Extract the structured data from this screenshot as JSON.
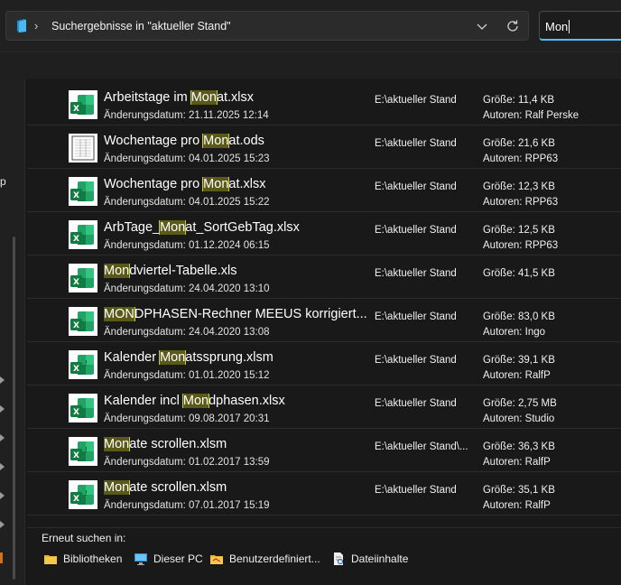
{
  "address": {
    "path": "Suchergebnisse in \"aktueller Stand\"",
    "separator": "›",
    "folder_icon": "folder-icon",
    "dropdown_icon": "chevron-down-icon",
    "refresh_icon": "refresh-icon"
  },
  "search": {
    "value": "Mon"
  },
  "nav": {
    "partial_label": "p"
  },
  "colors": {
    "accent": "#4cc2ff",
    "highlight_bg": "#5a5a1a",
    "highlight_border": "#c8c84a",
    "excel_green": "#1f9d55"
  },
  "results": [
    {
      "name_pre": "Arbeitstage im ",
      "name_hl": "Mon",
      "name_post": "at.xlsx",
      "date": "Änderungsdatum: 21.11.2025 12:14",
      "location": "E:\\aktueller Stand",
      "size": "Größe: 11,4 KB",
      "author": "Autoren: Ralf Perske",
      "icon": "excel"
    },
    {
      "name_pre": "Wochentage pro ",
      "name_hl": "Mon",
      "name_post": "at.ods",
      "date": "Änderungsdatum: 04.01.2025 15:23",
      "location": "E:\\aktueller Stand",
      "size": "Größe: 21,6 KB",
      "author": "Autoren: RPP63",
      "icon": "ods"
    },
    {
      "name_pre": "Wochentage pro ",
      "name_hl": "Mon",
      "name_post": "at.xlsx",
      "date": "Änderungsdatum: 04.01.2025 15:22",
      "location": "E:\\aktueller Stand",
      "size": "Größe: 12,3 KB",
      "author": "Autoren: RPP63",
      "icon": "excel"
    },
    {
      "name_pre": "ArbTage_",
      "name_hl": "Mon",
      "name_post": "at_SortGebTag.xlsx",
      "date": "Änderungsdatum: 01.12.2024 06:15",
      "location": "E:\\aktueller Stand",
      "size": "Größe: 12,5 KB",
      "author": "Autoren: RPP63",
      "icon": "excel"
    },
    {
      "name_pre": "",
      "name_hl": "Mon",
      "name_post": "dviertel-Tabelle.xls",
      "date": "Änderungsdatum: 24.04.2020 13:10",
      "location": "E:\\aktueller Stand",
      "size": "Größe: 41,5 KB",
      "author": "",
      "icon": "excel"
    },
    {
      "name_pre": "",
      "name_hl": "MON",
      "name_post": "DPHASEN-Rechner MEEUS korrigiert...",
      "date": "Änderungsdatum: 24.04.2020 13:08",
      "location": "E:\\aktueller Stand",
      "size": "Größe: 83,0 KB",
      "author": "Autoren: Ingo",
      "icon": "excel"
    },
    {
      "name_pre": "Kalender ",
      "name_hl": "Mon",
      "name_post": "atssprung.xlsm",
      "date": "Änderungsdatum: 01.01.2020 15:12",
      "location": "E:\\aktueller Stand",
      "size": "Größe: 39,1 KB",
      "author": "Autoren: RalfP",
      "icon": "excel-macro"
    },
    {
      "name_pre": "Kalender incl ",
      "name_hl": "Mon",
      "name_post": "dphasen.xlsx",
      "date": "Änderungsdatum: 09.08.2017 20:31",
      "location": "E:\\aktueller Stand",
      "size": "Größe: 2,75 MB",
      "author": "Autoren: Studio",
      "icon": "excel"
    },
    {
      "name_pre": "",
      "name_hl": "Mon",
      "name_post": "ate scrollen.xlsm",
      "date": "Änderungsdatum: 01.02.2017 13:59",
      "location": "E:\\aktueller Stand\\...",
      "size": "Größe: 36,3 KB",
      "author": "Autoren: RalfP",
      "icon": "excel-macro"
    },
    {
      "name_pre": "",
      "name_hl": "Mon",
      "name_post": "ate scrollen.xlsm",
      "date": "Änderungsdatum: 07.01.2017 15:19",
      "location": "E:\\aktueller Stand",
      "size": "Größe: 35,1 KB",
      "author": "Autoren: RalfP",
      "icon": "excel-macro"
    }
  ],
  "search_again": {
    "title": "Erneut suchen in:",
    "options": [
      {
        "label": "Bibliotheken",
        "icon": "libraries-icon"
      },
      {
        "label": "Dieser PC",
        "icon": "this-pc-icon"
      },
      {
        "label": "Benutzerdefiniert...",
        "icon": "custom-folder-icon"
      },
      {
        "label": "Dateiinhalte",
        "icon": "file-contents-icon"
      }
    ]
  }
}
